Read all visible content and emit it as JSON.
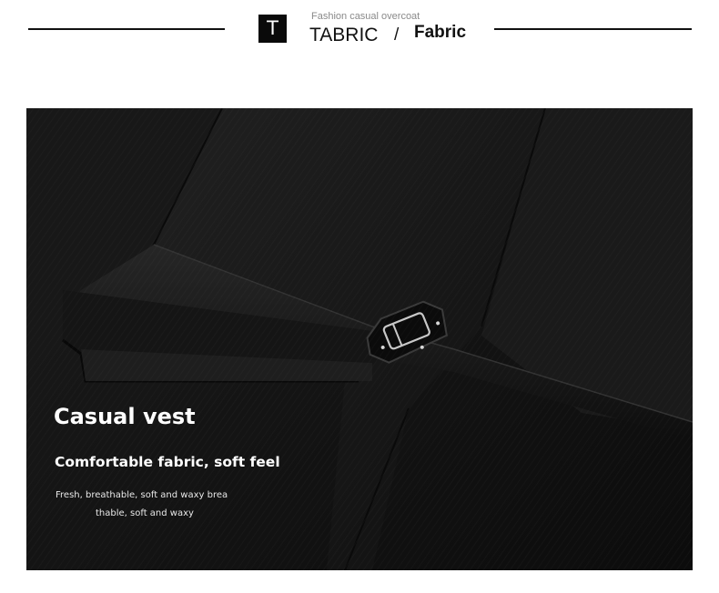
{
  "header": {
    "icon_letter": "T",
    "subtitle": "Fashion casual overcoat",
    "title_en": "TABRIC",
    "separator": "/",
    "title_fabric": "Fabric"
  },
  "photo": {
    "subject": "black-vest-back-strap-buckle",
    "colors": {
      "fabric": "#121212",
      "highlight": "#2a2a2a",
      "buckle": "#c8c8c8"
    }
  },
  "caption": {
    "title": "Casual vest",
    "subtitle": "Comfortable fabric, soft feel",
    "body_line1": "Fresh, breathable, soft and waxy brea",
    "body_line2": "thable, soft and waxy"
  }
}
